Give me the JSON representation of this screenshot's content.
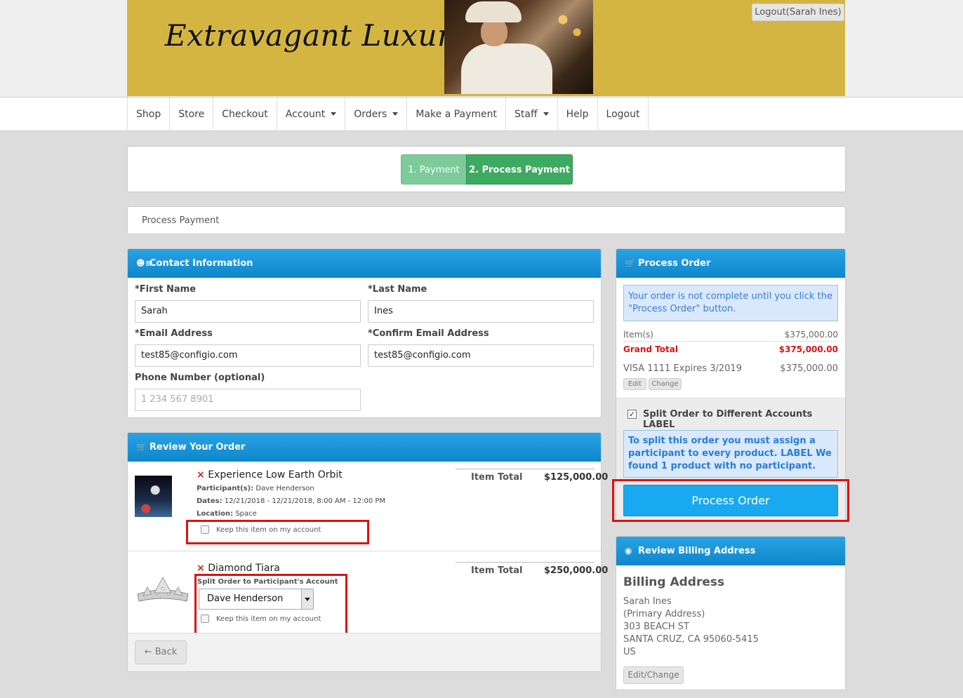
{
  "header": {
    "brand": "Extravagant Luxuries",
    "logout_label": "Logout(Sarah Ines)"
  },
  "nav": {
    "items": [
      {
        "label": "Shop",
        "dropdown": false
      },
      {
        "label": "Store",
        "dropdown": false
      },
      {
        "label": "Checkout",
        "dropdown": false
      },
      {
        "label": "Account",
        "dropdown": true
      },
      {
        "label": "Orders",
        "dropdown": true
      },
      {
        "label": "Make a Payment",
        "dropdown": false
      },
      {
        "label": "Staff",
        "dropdown": true
      },
      {
        "label": "Help",
        "dropdown": false
      },
      {
        "label": "Logout",
        "dropdown": false
      }
    ]
  },
  "steps": {
    "step1": "1. Payment",
    "step2": "2. Process Payment"
  },
  "breadcrumb": "Process Payment",
  "contact": {
    "title": "Contact Information",
    "first_name_label": "*First Name",
    "first_name_value": "Sarah",
    "last_name_label": "*Last Name",
    "last_name_value": "Ines",
    "email_label": "*Email Address",
    "email_value": "test85@configio.com",
    "confirm_email_label": "*Confirm Email Address",
    "confirm_email_value": "test85@configio.com",
    "phone_label": "Phone Number (optional)",
    "phone_placeholder": "1 234 567 8901"
  },
  "review": {
    "title": "Review Your Order",
    "item_total_label": "Item Total",
    "items": [
      {
        "name": "Experience Low Earth Orbit",
        "participants_label": "Participant(s):",
        "participants": "Dave Henderson",
        "dates_label": "Dates:",
        "dates": "12/21/2018 - 12/21/2018, 8:00 AM - 12:00 PM",
        "location_label": "Location:",
        "location": "Space",
        "keep_label": "Keep this item on my account",
        "total": "$125,000.00"
      },
      {
        "name": "Diamond Tiara",
        "split_label": "Split Order to Participant's Account",
        "split_selected": "Dave Henderson",
        "keep_label": "Keep this item on my account",
        "total": "$250,000.00"
      }
    ],
    "back_label": "Back"
  },
  "process_order": {
    "title": "Process Order",
    "notice": "Your order is not complete until you click the \"Process Order\" button.",
    "items_label": "Item(s)",
    "items_value": "$375,000.00",
    "grand_total_label": "Grand Total",
    "grand_total_value": "$375,000.00",
    "card_label": "VISA 1111 Expires 3/2019",
    "card_value": "$375,000.00",
    "edit_label": "Edit",
    "change_label": "Change",
    "split_checkbox_label": "Split Order to Different Accounts LABEL",
    "split_info": "To split this order you must assign a participant to every product. LABEL We found 1 product with no participant.",
    "process_button": "Process Order"
  },
  "billing": {
    "panel_title": "Review Billing Address",
    "title": "Billing Address",
    "name": "Sarah Ines",
    "primary": "(Primary Address)",
    "street": "303 BEACH ST",
    "city": "SANTA CRUZ, CA 95060-5415",
    "country": "US",
    "edit_change_label": "Edit/Change"
  },
  "colors": {
    "header_blue": "#1a94d8",
    "step_active": "#3daa61",
    "process_button": "#19a9f1",
    "grand_total": "#d71414",
    "highlight_box": "#dd1111"
  }
}
